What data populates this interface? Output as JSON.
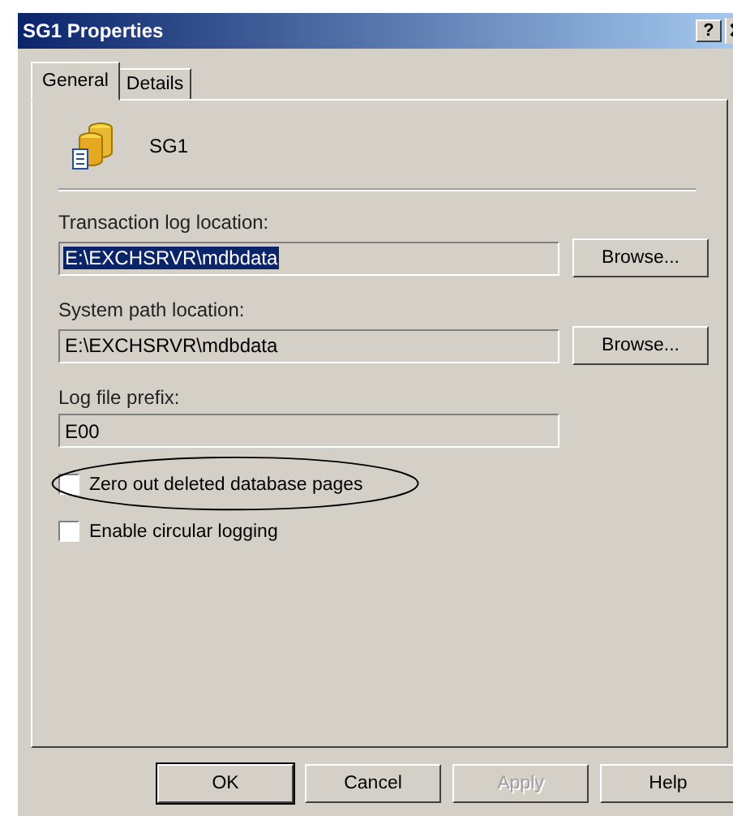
{
  "window": {
    "title": "SG1 Properties",
    "help_button": "?"
  },
  "tabs": [
    {
      "label": "General",
      "selected": true
    },
    {
      "label": "Details",
      "selected": false
    }
  ],
  "header": {
    "name": "SG1"
  },
  "fields": [
    {
      "label": "Transaction log location:",
      "value": "E:\\EXCHSRVR\\mdbdata",
      "selected": true,
      "button": "Browse..."
    },
    {
      "label": "System path location:",
      "value": "E:\\EXCHSRVR\\mdbdata",
      "selected": false,
      "button": "Browse..."
    },
    {
      "label": "Log file prefix:",
      "value": "E00",
      "selected": false
    }
  ],
  "checkboxes": [
    {
      "label": "Zero out deleted database pages",
      "checked": false,
      "circled": true
    },
    {
      "label": "Enable circular logging",
      "checked": false,
      "circled": false
    }
  ],
  "buttons": [
    {
      "label": "OK",
      "default": true,
      "disabled": false
    },
    {
      "label": "Cancel",
      "default": false,
      "disabled": false
    },
    {
      "label": "Apply",
      "default": false,
      "disabled": true
    },
    {
      "label": "Help",
      "default": false,
      "disabled": false
    }
  ]
}
